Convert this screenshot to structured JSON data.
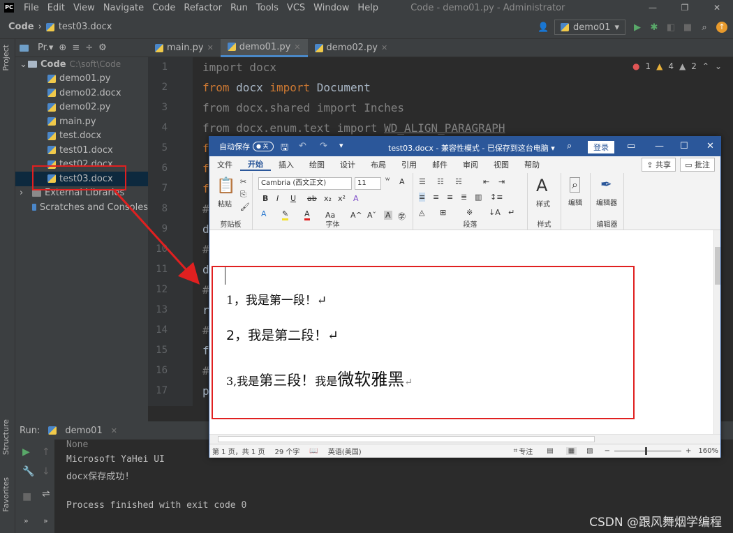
{
  "menubar": {
    "items": [
      "File",
      "Edit",
      "View",
      "Navigate",
      "Code",
      "Refactor",
      "Run",
      "Tools",
      "VCS",
      "Window",
      "Help"
    ],
    "title": "Code - demo01.py - Administrator"
  },
  "toolbar": {
    "crumb_root": "Code",
    "crumb_file": "test03.docx",
    "run_config": "demo01"
  },
  "project": {
    "header": "Pr.▾",
    "root_name": "Code",
    "root_path": "C:\\soft\\Code",
    "files": [
      "demo01.py",
      "demo02.docx",
      "demo02.py",
      "main.py",
      "test.docx",
      "test01.docx",
      "test02.docx",
      "test03.docx"
    ],
    "external": "External Libraries",
    "scratches": "Scratches and Consoles"
  },
  "sidebar": {
    "project_label": "Project",
    "structure_label": "Structure",
    "favorites_label": "Favorites"
  },
  "tabs": [
    "main.py",
    "demo01.py",
    "demo02.py"
  ],
  "editor": {
    "line_numbers": [
      "1",
      "2",
      "3",
      "4",
      "5",
      "6",
      "7",
      "8",
      "9",
      "10",
      "11",
      "12",
      "13",
      "14",
      "15",
      "16",
      "17"
    ],
    "inspections": {
      "errors": "1",
      "warnings": "4",
      "weak": "2"
    }
  },
  "run": {
    "label": "Run:",
    "config": "demo01",
    "output": [
      "None",
      "Microsoft YaHei UI",
      "docx保存成功!",
      "",
      "Process finished with exit code 0"
    ]
  },
  "watermark": "CSDN @跟风舞烟学编程",
  "word": {
    "autosave": "自动保存",
    "toggle": "关",
    "title": "test03.docx  -  兼容性模式 - 已保存到这台电脑 ▾",
    "login": "登录",
    "tabs": [
      "文件",
      "开始",
      "插入",
      "绘图",
      "设计",
      "布局",
      "引用",
      "邮件",
      "审阅",
      "视图",
      "帮助"
    ],
    "share": "共享",
    "comment": "批注",
    "ribbon": {
      "clipboard": "剪贴板",
      "paste": "粘贴",
      "font_name": "Cambria (西文正文)",
      "font_size": "11",
      "font_group": "字体",
      "paragraph_group": "段落",
      "styles": "样式",
      "styles_group": "样式",
      "editing": "编辑",
      "editor": "编辑器",
      "editor_group": "编辑器"
    },
    "paragraphs": {
      "p1": "1，我是第一段！↵",
      "p2_num": "2，",
      "p2": "我是第二段！↵",
      "p3_a": "3,我是",
      "p3_b": "第三段！",
      "p3_c": "我是",
      "p3_d": "微软雅黑",
      "p3_e": "↵"
    },
    "status": {
      "page": "第 1 页，共 1 页",
      "words": "29 个字",
      "lang": "英语(美国)",
      "focus": "专注",
      "zoom": "160%"
    }
  }
}
